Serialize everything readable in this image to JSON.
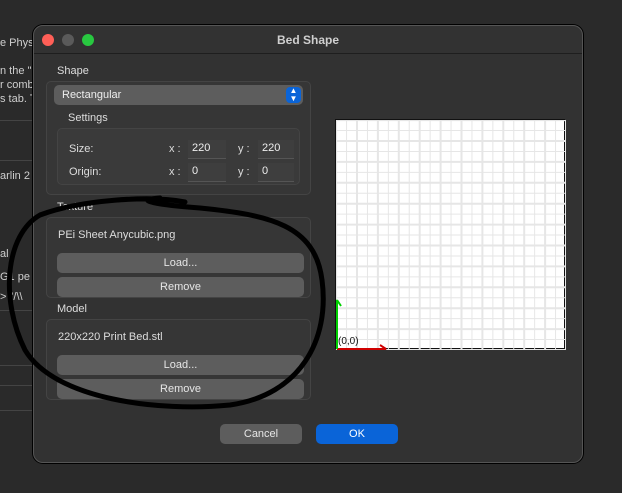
{
  "background": {
    "texts": [
      "e Phys",
      "n the \"",
      "r comb",
      "s tab. T",
      "arlin 2",
      "al :",
      "G1 pe",
      "> \"/\\\\"
    ]
  },
  "dialog": {
    "title": "Bed Shape",
    "shape": {
      "label": "Shape",
      "type_value": "Rectangular",
      "settings": {
        "label": "Settings",
        "size_label": "Size:",
        "origin_label": "Origin:",
        "x_label": "x :",
        "y_label": "y :",
        "size_x": "220",
        "size_y": "220",
        "origin_x": "0",
        "origin_y": "0"
      }
    },
    "texture": {
      "label": "Texture",
      "filename": "PEi Sheet Anycubic.png",
      "load": "Load...",
      "remove": "Remove"
    },
    "model": {
      "label": "Model",
      "filename": "220x220 Print Bed.stl",
      "load": "Load...",
      "remove": "Remove"
    },
    "preview": {
      "origin_label": "(0,0)"
    },
    "cancel": "Cancel",
    "ok": "OK"
  },
  "colors": {
    "accent": "#0a64d8",
    "close": "#ff5f57",
    "zoom": "#28c840",
    "x_axis": "#d00000",
    "y_axis": "#00d000"
  }
}
